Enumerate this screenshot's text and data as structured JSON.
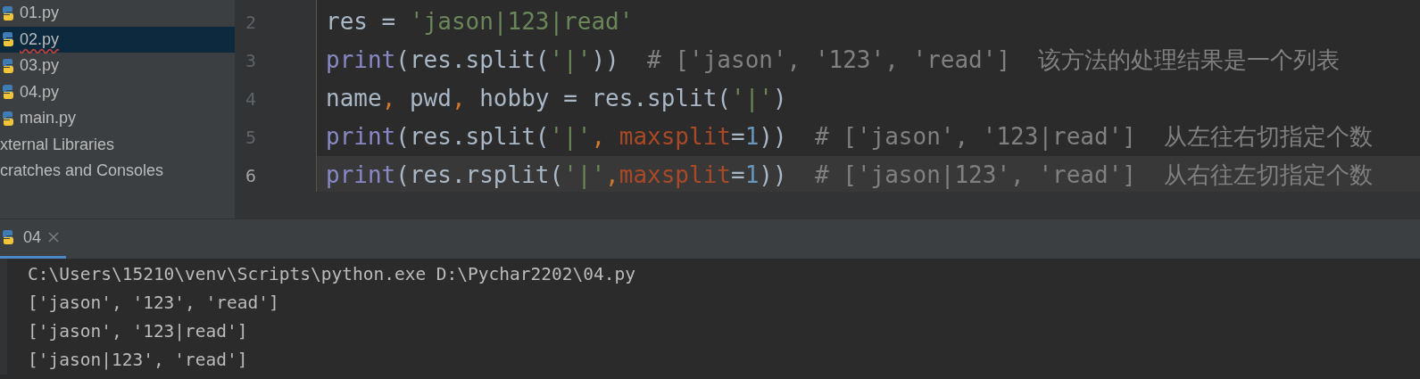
{
  "project_tree": [
    {
      "label": "01.py",
      "kind": "python",
      "selected": false,
      "error": false
    },
    {
      "label": "02.py",
      "kind": "python",
      "selected": true,
      "error": true
    },
    {
      "label": "03.py",
      "kind": "python",
      "selected": false,
      "error": false
    },
    {
      "label": "04.py",
      "kind": "python",
      "selected": false,
      "error": false
    },
    {
      "label": "main.py",
      "kind": "python",
      "selected": false,
      "error": false
    },
    {
      "label": "xternal Libraries",
      "kind": "group",
      "selected": false,
      "error": false
    },
    {
      "label": "cratches and Consoles",
      "kind": "group",
      "selected": false,
      "error": false
    }
  ],
  "editor": {
    "lines": [
      {
        "number": "2",
        "current": false,
        "tokens": [
          {
            "kind": "plain",
            "text": "res = "
          },
          {
            "kind": "string",
            "text": "'jason|123|read'"
          }
        ]
      },
      {
        "number": "3",
        "current": false,
        "tokens": [
          {
            "kind": "builtin",
            "text": "print"
          },
          {
            "kind": "plain",
            "text": "(res.split("
          },
          {
            "kind": "string",
            "text": "'|'"
          },
          {
            "kind": "plain",
            "text": "))  "
          },
          {
            "kind": "comment",
            "text": "# ['jason', '123', 'read']  该方法的处理结果是一个列表"
          }
        ]
      },
      {
        "number": "4",
        "current": false,
        "tokens": [
          {
            "kind": "plain",
            "text": "name"
          },
          {
            "kind": "punct",
            "text": ", "
          },
          {
            "kind": "plain",
            "text": "pwd"
          },
          {
            "kind": "punct",
            "text": ", "
          },
          {
            "kind": "plain",
            "text": "hobby = res.split("
          },
          {
            "kind": "string",
            "text": "'|'"
          },
          {
            "kind": "plain",
            "text": ")"
          }
        ]
      },
      {
        "number": "5",
        "current": false,
        "tokens": [
          {
            "kind": "builtin",
            "text": "print"
          },
          {
            "kind": "plain",
            "text": "(res.split("
          },
          {
            "kind": "string",
            "text": "'|'"
          },
          {
            "kind": "punct",
            "text": ", "
          },
          {
            "kind": "param",
            "text": "maxsplit"
          },
          {
            "kind": "plain",
            "text": "="
          },
          {
            "kind": "number",
            "text": "1"
          },
          {
            "kind": "plain",
            "text": "))  "
          },
          {
            "kind": "comment",
            "text": "# ['jason', '123|read']  从左往右切指定个数"
          }
        ]
      },
      {
        "number": "6",
        "current": true,
        "tokens": [
          {
            "kind": "builtin",
            "text": "print"
          },
          {
            "kind": "plain",
            "text": "(res.rsplit("
          },
          {
            "kind": "string",
            "text": "'|'"
          },
          {
            "kind": "punct",
            "text": ","
          },
          {
            "kind": "param",
            "text": "maxsplit"
          },
          {
            "kind": "plain",
            "text": "="
          },
          {
            "kind": "number",
            "text": "1"
          },
          {
            "kind": "plain",
            "text": "))  "
          },
          {
            "kind": "comment",
            "text": "# ['jason|123', 'read']  从右往左切指定个数"
          }
        ]
      }
    ]
  },
  "run_panel": {
    "tabs": [
      {
        "label": "04",
        "selected": true
      }
    ],
    "output": [
      "C:\\Users\\15210\\venv\\Scripts\\python.exe D:\\Pychar2202\\04.py",
      "['jason', '123', 'read']",
      "['jason', '123|read']",
      "['jason|123', 'read']"
    ]
  }
}
